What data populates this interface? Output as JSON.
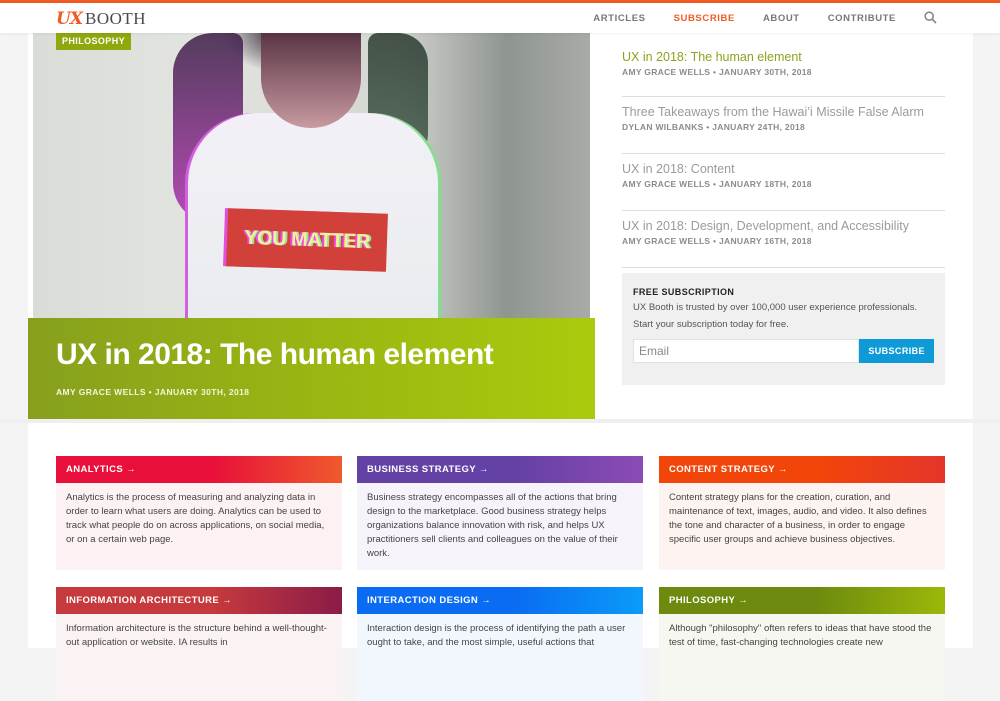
{
  "header": {
    "logo_ux": "UX",
    "logo_booth": "BOOTH",
    "nav": [
      {
        "label": "ARTICLES",
        "active": false
      },
      {
        "label": "SUBSCRIBE",
        "active": true
      },
      {
        "label": "ABOUT",
        "active": false
      },
      {
        "label": "CONTRIBUTE",
        "active": false
      }
    ],
    "search_icon": "search-icon",
    "accent_color": "#f15a22"
  },
  "hero": {
    "category": "PHILOSOPHY",
    "shirt_text": "YOU MATTER",
    "title": "UX in 2018: The human element",
    "meta": "AMY GRACE WELLS • JANUARY 30TH, 2018",
    "color": "#96b114"
  },
  "sidebar": {
    "articles": [
      {
        "title": "UX in 2018: The human element",
        "meta": "AMY GRACE WELLS • JANUARY 30TH, 2018",
        "current": true
      },
      {
        "title": "Three Takeaways from the Hawai’i Missile False Alarm",
        "meta": "DYLAN WILBANKS • JANUARY 24TH, 2018",
        "current": false
      },
      {
        "title": "UX in 2018: Content",
        "meta": "AMY GRACE WELLS • JANUARY 18TH, 2018",
        "current": false
      },
      {
        "title": "UX in 2018: Design, Development, and Accessibility",
        "meta": "AMY GRACE WELLS • JANUARY 16TH, 2018",
        "current": false
      }
    ],
    "subscription": {
      "heading": "FREE SUBSCRIPTION",
      "line1": "UX Booth is trusted by over 100,000 user experience professionals.",
      "line2": "Start your subscription today for free.",
      "email_placeholder": "Email",
      "button": "SUBSCRIBE",
      "button_color": "#0e9ad6"
    }
  },
  "topics": [
    {
      "title": "ANALYTICS →",
      "text": "Analytics is the process of measuring and analyzing data in order to learn what users are doing. Analytics can be used to track what people do on across applications, on social media, or on a certain web page.",
      "from": "#e8103a",
      "to": "#ef5a2c",
      "bg": "#fdf2f3"
    },
    {
      "title": "BUSINESS STRATEGY →",
      "text": "Business strategy encompasses all of the actions that bring design to the marketplace. Good business strategy helps organizations balance innovation with risk, and helps UX practitioners sell clients and colleagues on the value of their work.",
      "from": "#6441a5",
      "to": "#8c4bb5",
      "bg": "#f6f4fa"
    },
    {
      "title": "CONTENT STRATEGY →",
      "text": "Content strategy plans for the creation, curation, and maintenance of text, images, audio, and video. It also defines the tone and character of a business, in order to engage specific user groups and achieve business objectives.",
      "from": "#f2450a",
      "to": "#e5352a",
      "bg": "#fdf3f1"
    },
    {
      "title": "INFORMATION ARCHITECTURE →",
      "text": "Information architecture is the structure behind a well-thought-out application or website. IA results in",
      "from": "#c6393c",
      "to": "#8a1c48",
      "bg": "#fbf3f3"
    },
    {
      "title": "INTERACTION DESIGN →",
      "text": "Interaction design is the process of identifying the path a user ought to take, and the most simple, useful actions that",
      "from": "#0a6cf2",
      "to": "#0a9cf8",
      "bg": "#f2f7fd"
    },
    {
      "title": "PHILOSOPHY →",
      "text": "Although \"philosophy\" often refers to ideas that have stood the test of time, fast-changing technologies create new",
      "from": "#6d8a0e",
      "to": "#9bb80a",
      "bg": "#f6f7f0"
    }
  ]
}
